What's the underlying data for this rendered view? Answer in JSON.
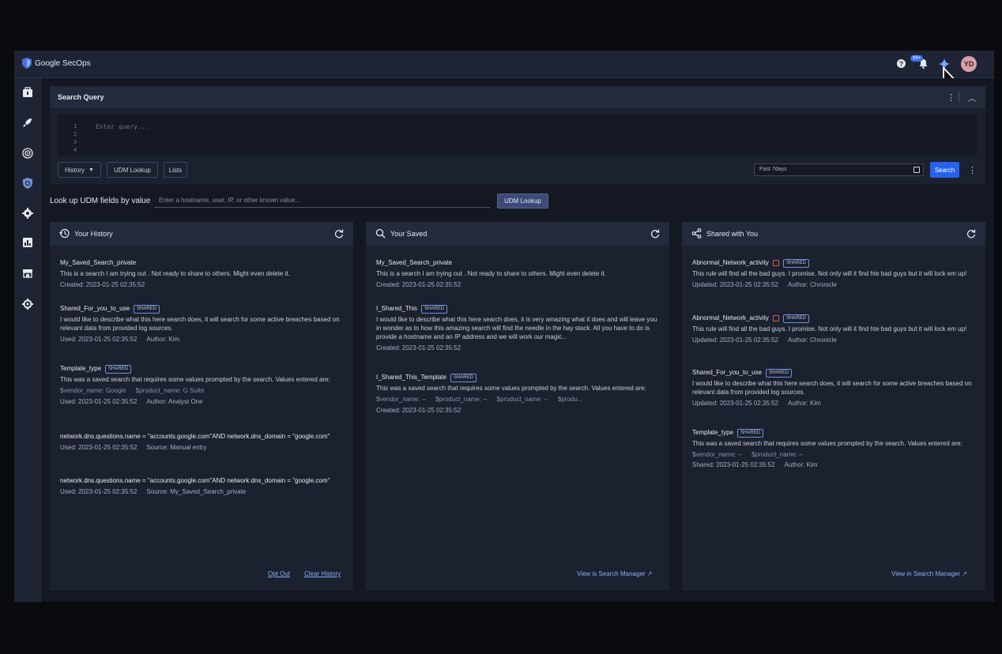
{
  "app": {
    "title": "Google SecOps",
    "notification_count": "99+",
    "user_initials": "YD"
  },
  "search_query": {
    "title": "Search Query",
    "line_numbers": [
      "1",
      "2",
      "3",
      "4"
    ],
    "placeholder": "Enter query...",
    "history_label": "History",
    "udm_lookup_label": "UDM Lookup",
    "lists_label": "Lists",
    "date_range": "Past 7days",
    "search_label": "Search"
  },
  "lookup": {
    "label": "Look up UDM fields by value",
    "placeholder": "Enter a hostname, user, IP, or other known value...",
    "button": "UDM Lookup"
  },
  "panels": {
    "history": {
      "title": "Your History",
      "items": [
        {
          "title": "My_Saved_Search_private",
          "desc": "This is a search I am trying out . Not ready to share to others. Might even delete it.",
          "meta1": "Created: 2023-01-25 02:35:52"
        },
        {
          "title": "Shared_For_you_to_use",
          "tag": "SHARED",
          "desc": "I would like to describe what this here search does, it will search for some active breaches based on relevant data from provided log sources.",
          "meta1": "Used: 2023-01-25 02:35:52",
          "meta2": "Author: Kim"
        },
        {
          "title": "Template_type",
          "tag": "SHARED",
          "desc": "This was a saved search that requires some values prompted by the search.   Values entered are:",
          "var1": "$vendor_name: Google",
          "var2": "$product_name: G Suite",
          "meta1": "Used: 2023-01-25 02:35:52",
          "meta2": "Author: Analyst One"
        },
        {
          "title": "network.dns.questions.name = \"accounts.google.com\"AND network.dns_domain = \"google.com\"",
          "meta1": "Used: 2023-01-25 02:35:52",
          "meta2": "Source: Manual entry"
        },
        {
          "title": "network.dns.questions.name = \"accounts.google.com\"AND network.dns_domain = \"google.com\"",
          "meta1": "Used: 2023-01-25 02:35:52",
          "meta2": "Source: My_Saved_Search_private"
        }
      ],
      "opt_out": "Opt Out",
      "clear_history": "Clear History"
    },
    "saved": {
      "title": "Your Saved",
      "items": [
        {
          "title": "My_Saved_Search_private",
          "desc": "This is a search I am trying out . Not ready to share to others. Might even delete it.",
          "meta1": "Created: 2023-01-25 02:35:52"
        },
        {
          "title": "I_Shared_This",
          "tag": "SHARED",
          "desc": "I would like to describe what this here search does, it is very amazing what it does and will leave you in wonder as to how this amazing search will find the needle in the hay stack. All you have to do is provide a hostname and an IP address and we will work our magic..",
          "meta1": "Created: 2023-01-25 02:35:52"
        },
        {
          "title": "I_Shared_This_Template",
          "tag": "SHARED",
          "desc": "This was a saved search that requires some values prompted by the search.   Values entered are:",
          "var1": "$vendor_name: --",
          "var2": "$product_name: --",
          "var3": "$product_name: --",
          "var4": "$produ...",
          "meta1": "Created: 2023-01-25 02:35:52"
        }
      ],
      "link": "View is Search Manager"
    },
    "shared": {
      "title": "Shared with You",
      "items": [
        {
          "title": "Abnormal_Network_activity",
          "tag": "SHARED",
          "desc": "This rule will find all the bad guys. I promise. Not only will it find hte bad guys but it will lock em up!",
          "meta1": "Updated: 2023-01-25 02:35:52",
          "meta2": "Author: Chronicle"
        },
        {
          "title": "Abnormal_Network_activity",
          "tag": "SHARED",
          "desc": "This rule will find all the bad guys. I promise. Not only will it find hte bad guys but it will lock em up!",
          "meta1": "Updated: 2023-01-25 02:35:52",
          "meta2": "Author: Chronicle"
        },
        {
          "title": "Shared_For_you_to_use",
          "tag": "SHARED",
          "desc": "I would like to describe what this here search does, it will search for some active breaches based on relevant data from provided log sources.",
          "meta1": "Updated: 2023-01-25 02:35:52",
          "meta2": "Author: Kim"
        },
        {
          "title": "Template_type",
          "tag": "SHARED",
          "desc": "This was a saved search that requires some values prompted by the search.   Values entered are:",
          "var1": "$vendor_name: --",
          "var2": "$product_name: --",
          "meta1": "Shared: 2023-01-25 02:35:52",
          "meta2": "Author: Kim"
        }
      ],
      "link": "View in Search Manager"
    }
  },
  "colors": {
    "accent": "#2563eb",
    "tag_border": "#6f8fd6",
    "link": "#8ab0f5"
  }
}
